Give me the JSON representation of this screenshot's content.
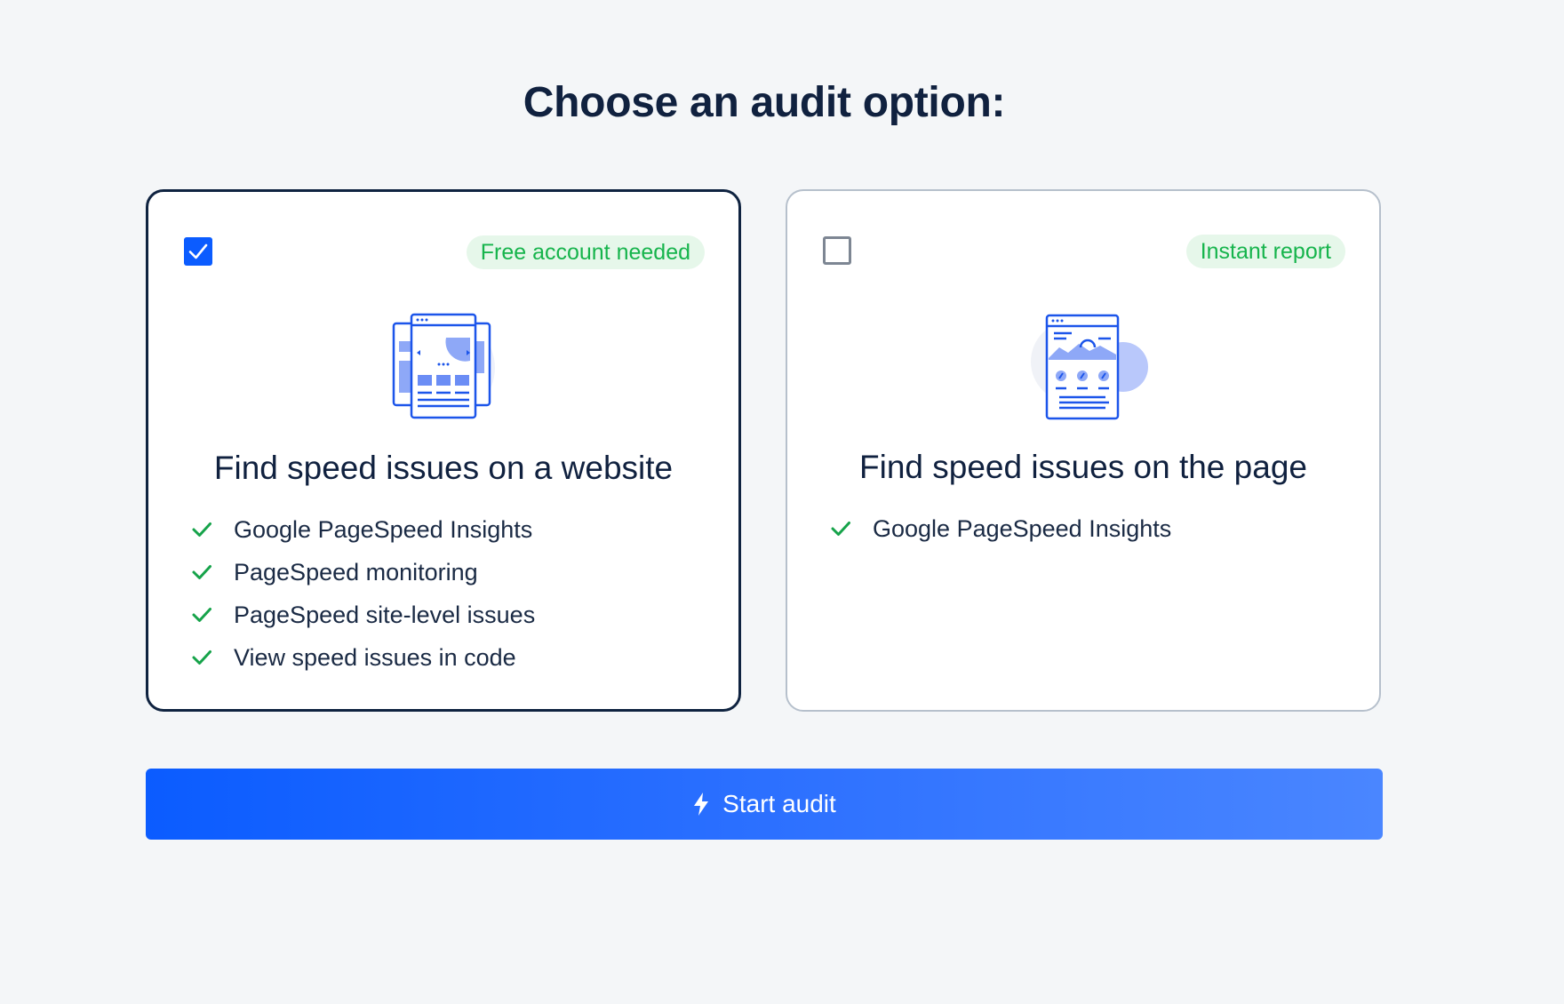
{
  "page": {
    "title": "Choose an audit option:"
  },
  "options": [
    {
      "badge": "Free account needed",
      "title": "Find speed issues on a website",
      "selected": true,
      "features": [
        "Google PageSpeed Insights",
        "PageSpeed monitoring",
        "PageSpeed site-level issues",
        "View speed issues in code"
      ]
    },
    {
      "badge": "Instant report",
      "title": "Find speed issues on the page",
      "selected": false,
      "features": [
        "Google PageSpeed Insights"
      ]
    }
  ],
  "actions": {
    "start_label": "Start audit"
  },
  "colors": {
    "primary": "#0b5cff",
    "badge_text": "#16b44c",
    "badge_bg": "#e6f7ea",
    "heading": "#10213f"
  },
  "icons": {
    "check": "checkmark-icon",
    "button": "lightning-icon",
    "illustration_website": "website-pages-illustration",
    "illustration_page": "single-page-illustration"
  }
}
